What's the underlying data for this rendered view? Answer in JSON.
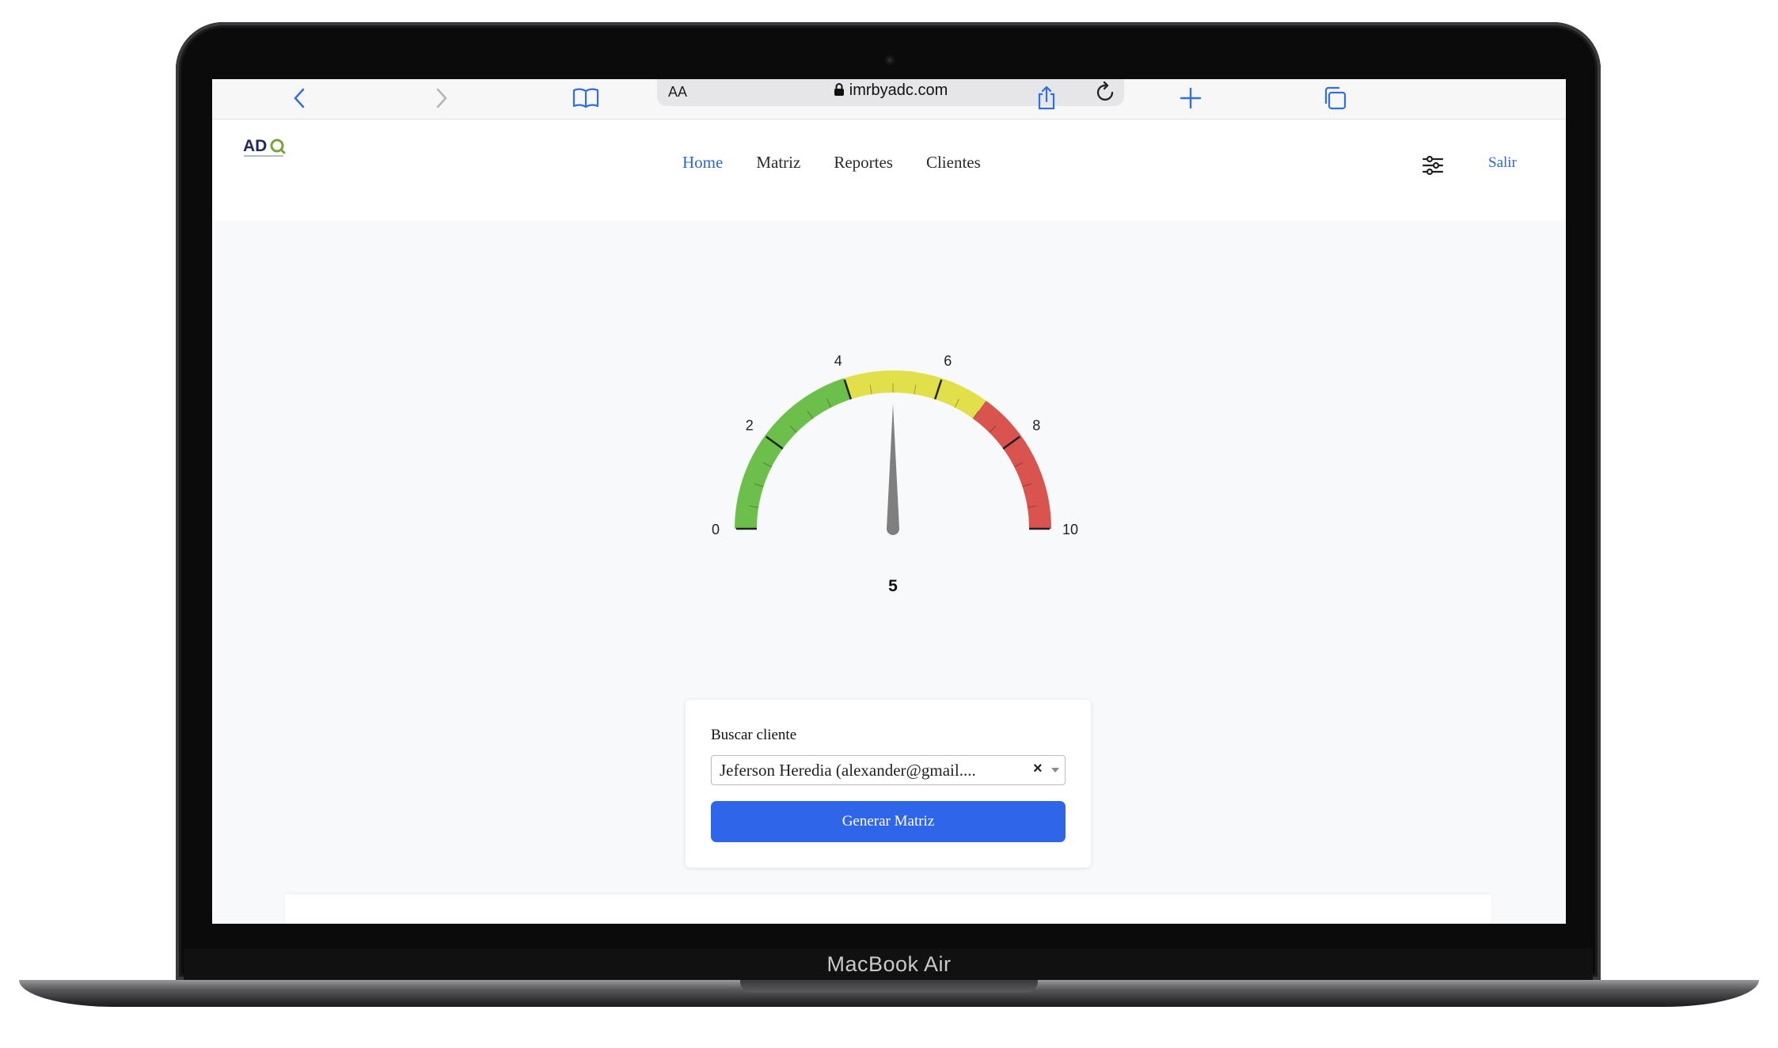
{
  "browser": {
    "text_size_label": "AA",
    "url": "imrbyadc.com"
  },
  "site": {
    "logo_text": "ADC",
    "nav": [
      {
        "label": "Home",
        "active": true
      },
      {
        "label": "Matriz",
        "active": false
      },
      {
        "label": "Reportes",
        "active": false
      },
      {
        "label": "Clientes",
        "active": false
      }
    ],
    "logout_label": "Salir"
  },
  "gauge": {
    "value": 5,
    "value_label": "5",
    "min": 0,
    "max": 10,
    "tick_labels": [
      "0",
      "2",
      "4",
      "6",
      "8",
      "10"
    ],
    "segments": [
      {
        "from": 0,
        "to": 4,
        "color": "#6dbf4b"
      },
      {
        "from": 4,
        "to": 7,
        "color": "#e2e04a"
      },
      {
        "from": 7,
        "to": 10,
        "color": "#d9534f"
      }
    ],
    "needle_color": "#7f7f7f"
  },
  "search_card": {
    "label": "Buscar cliente",
    "selected_value": "Jeferson Heredia (alexander@gmail....",
    "clear_symbol": "×",
    "button_label": "Generar Matriz"
  },
  "device": {
    "label": "MacBook Air"
  }
}
